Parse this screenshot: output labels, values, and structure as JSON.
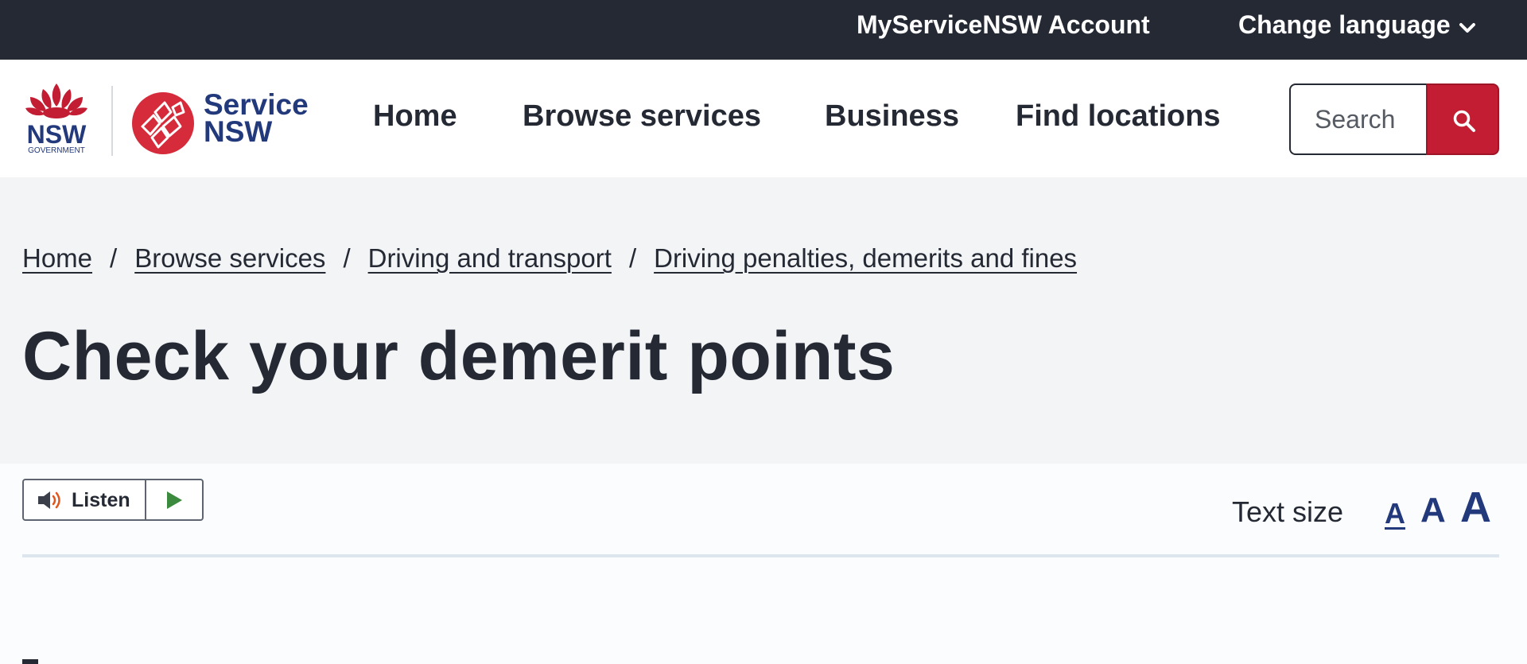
{
  "topbar": {
    "account_label": "MyServiceNSW Account",
    "language_label": "Change language"
  },
  "logos": {
    "nsw_word": "NSW",
    "nsw_sub": "GOVERNMENT",
    "service_line1": "Service",
    "service_line2": "NSW"
  },
  "nav": {
    "items": [
      "Home",
      "Browse services",
      "Business",
      "Find locations"
    ]
  },
  "search": {
    "placeholder": "Search"
  },
  "breadcrumb": {
    "items": [
      "Home",
      "Browse services",
      "Driving and transport",
      "Driving penalties, demerits and fines"
    ],
    "separator": "/"
  },
  "page": {
    "title": "Check your demerit points"
  },
  "listen": {
    "label": "Listen"
  },
  "text_size": {
    "label": "Text size",
    "options": [
      "A",
      "A",
      "A"
    ],
    "selected": 0
  },
  "colors": {
    "topbar": "#242934",
    "brand_blue": "#22397b",
    "brand_red": "#c21d33",
    "hero_bg": "#f3f4f6"
  }
}
